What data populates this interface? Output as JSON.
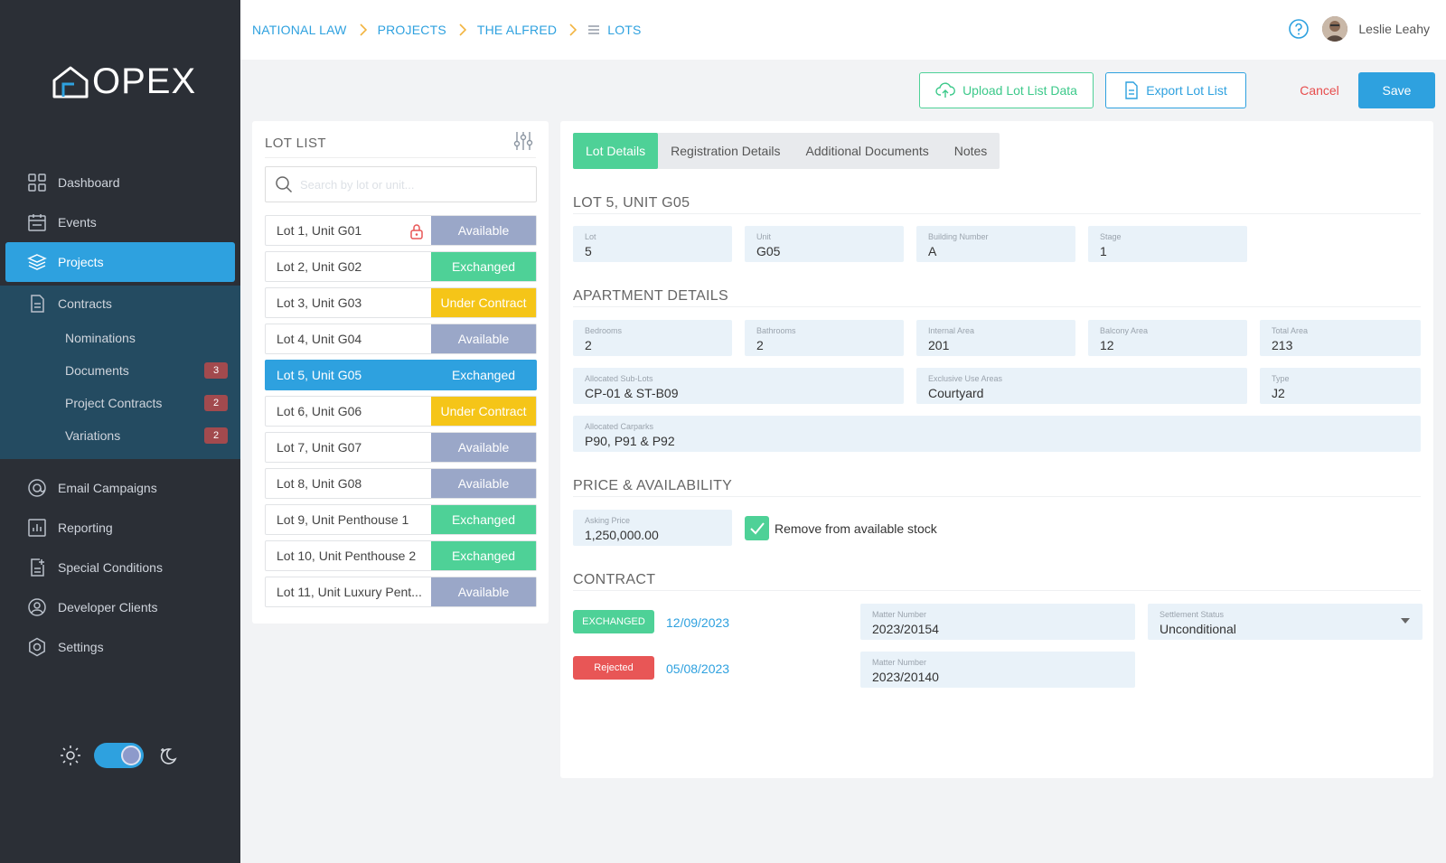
{
  "app": {
    "logo_text": "OPEX"
  },
  "sidebar": {
    "items": [
      {
        "label": "Dashboard",
        "icon": "grid-icon"
      },
      {
        "label": "Events",
        "icon": "calendar-icon"
      },
      {
        "label": "Projects",
        "icon": "layers-icon",
        "active": true
      },
      {
        "label": "Contracts",
        "icon": "document-icon"
      }
    ],
    "contracts_sub": [
      {
        "label": "Nominations",
        "badge": ""
      },
      {
        "label": "Documents",
        "badge": "3"
      },
      {
        "label": "Project Contracts",
        "badge": "2"
      },
      {
        "label": "Variations",
        "badge": "2"
      }
    ],
    "lower_items": [
      {
        "label": "Email Campaigns",
        "icon": "at-icon"
      },
      {
        "label": "Reporting",
        "icon": "bar-chart-icon"
      },
      {
        "label": "Special Conditions",
        "icon": "doc-plus-icon"
      },
      {
        "label": "Developer Clients",
        "icon": "user-circle-icon"
      },
      {
        "label": "Settings",
        "icon": "settings-icon"
      }
    ],
    "theme": {
      "dark_mode": true
    }
  },
  "breadcrumb": [
    "NATIONAL LAW",
    "PROJECTS",
    "THE ALFRED",
    "LOTS"
  ],
  "user": {
    "name": "Leslie Leahy"
  },
  "actions": {
    "upload": "Upload Lot List Data",
    "export": "Export Lot List",
    "cancel": "Cancel",
    "save": "Save"
  },
  "lot_list": {
    "title": "LOT LIST",
    "search_placeholder": "Search by lot or unit...",
    "lots": [
      {
        "name": "Lot 1, Unit G01",
        "status": "Available",
        "color": "#9aa7c8",
        "locked": true
      },
      {
        "name": "Lot 2, Unit G02",
        "status": "Exchanged",
        "color": "#4ed197"
      },
      {
        "name": "Lot 3, Unit G03",
        "status": "Under Contract",
        "color": "#f5c518"
      },
      {
        "name": "Lot 4, Unit G04",
        "status": "Available",
        "color": "#9aa7c8"
      },
      {
        "name": "Lot 5, Unit G05",
        "status": "Exchanged",
        "color": "#2ea1df",
        "selected": true
      },
      {
        "name": "Lot 6, Unit G06",
        "status": "Under Contract",
        "color": "#f5c518"
      },
      {
        "name": "Lot 7, Unit G07",
        "status": "Available",
        "color": "#9aa7c8"
      },
      {
        "name": "Lot 8, Unit G08",
        "status": "Available",
        "color": "#9aa7c8"
      },
      {
        "name": "Lot 9, Unit Penthouse 1",
        "status": "Exchanged",
        "color": "#4ed197"
      },
      {
        "name": "Lot 10, Unit Penthouse 2",
        "status": "Exchanged",
        "color": "#4ed197"
      },
      {
        "name": "Lot 11, Unit Luxury Pent...",
        "status": "Available",
        "color": "#9aa7c8"
      }
    ]
  },
  "tabs": [
    "Lot Details",
    "Registration Details",
    "Additional Documents",
    "Notes"
  ],
  "details": {
    "title": "LOT 5, UNIT G05",
    "lot_fields": [
      {
        "label": "Lot",
        "value": "5"
      },
      {
        "label": "Unit",
        "value": "G05"
      },
      {
        "label": "Building Number",
        "value": "A"
      },
      {
        "label": "Stage",
        "value": "1"
      }
    ],
    "apartment_title": "APARTMENT DETAILS",
    "apartment_row1": [
      {
        "label": "Bedrooms",
        "value": "2"
      },
      {
        "label": "Bathrooms",
        "value": "2"
      },
      {
        "label": "Internal Area",
        "value": "201"
      },
      {
        "label": "Balcony Area",
        "value": "12"
      },
      {
        "label": "Total Area",
        "value": "213"
      }
    ],
    "apartment_row2": [
      {
        "label": "Allocated Sub-Lots",
        "value": "CP-01 & ST-B09"
      },
      {
        "label": "Exclusive Use Areas",
        "value": "Courtyard"
      },
      {
        "label": "Type",
        "value": "J2"
      }
    ],
    "carparks": {
      "label": "Allocated Carparks",
      "value": "P90, P91 & P92"
    },
    "price_title": "PRICE & AVAILABILITY",
    "asking_price": {
      "label": "Asking Price",
      "value": "1,250,000.00"
    },
    "remove_stock": {
      "label": "Remove from available stock",
      "checked": true
    },
    "contract_title": "CONTRACT",
    "contracts": [
      {
        "status": "EXCHANGED",
        "color": "#4ed197",
        "date": "12/09/2023",
        "matter_label": "Matter Number",
        "matter": "2023/20154",
        "settlement_label": "Settlement Status",
        "settlement": "Unconditional"
      },
      {
        "status": "Rejected",
        "color": "#e85656",
        "date": "05/08/2023",
        "matter_label": "Matter Number",
        "matter": "2023/20140"
      }
    ]
  }
}
